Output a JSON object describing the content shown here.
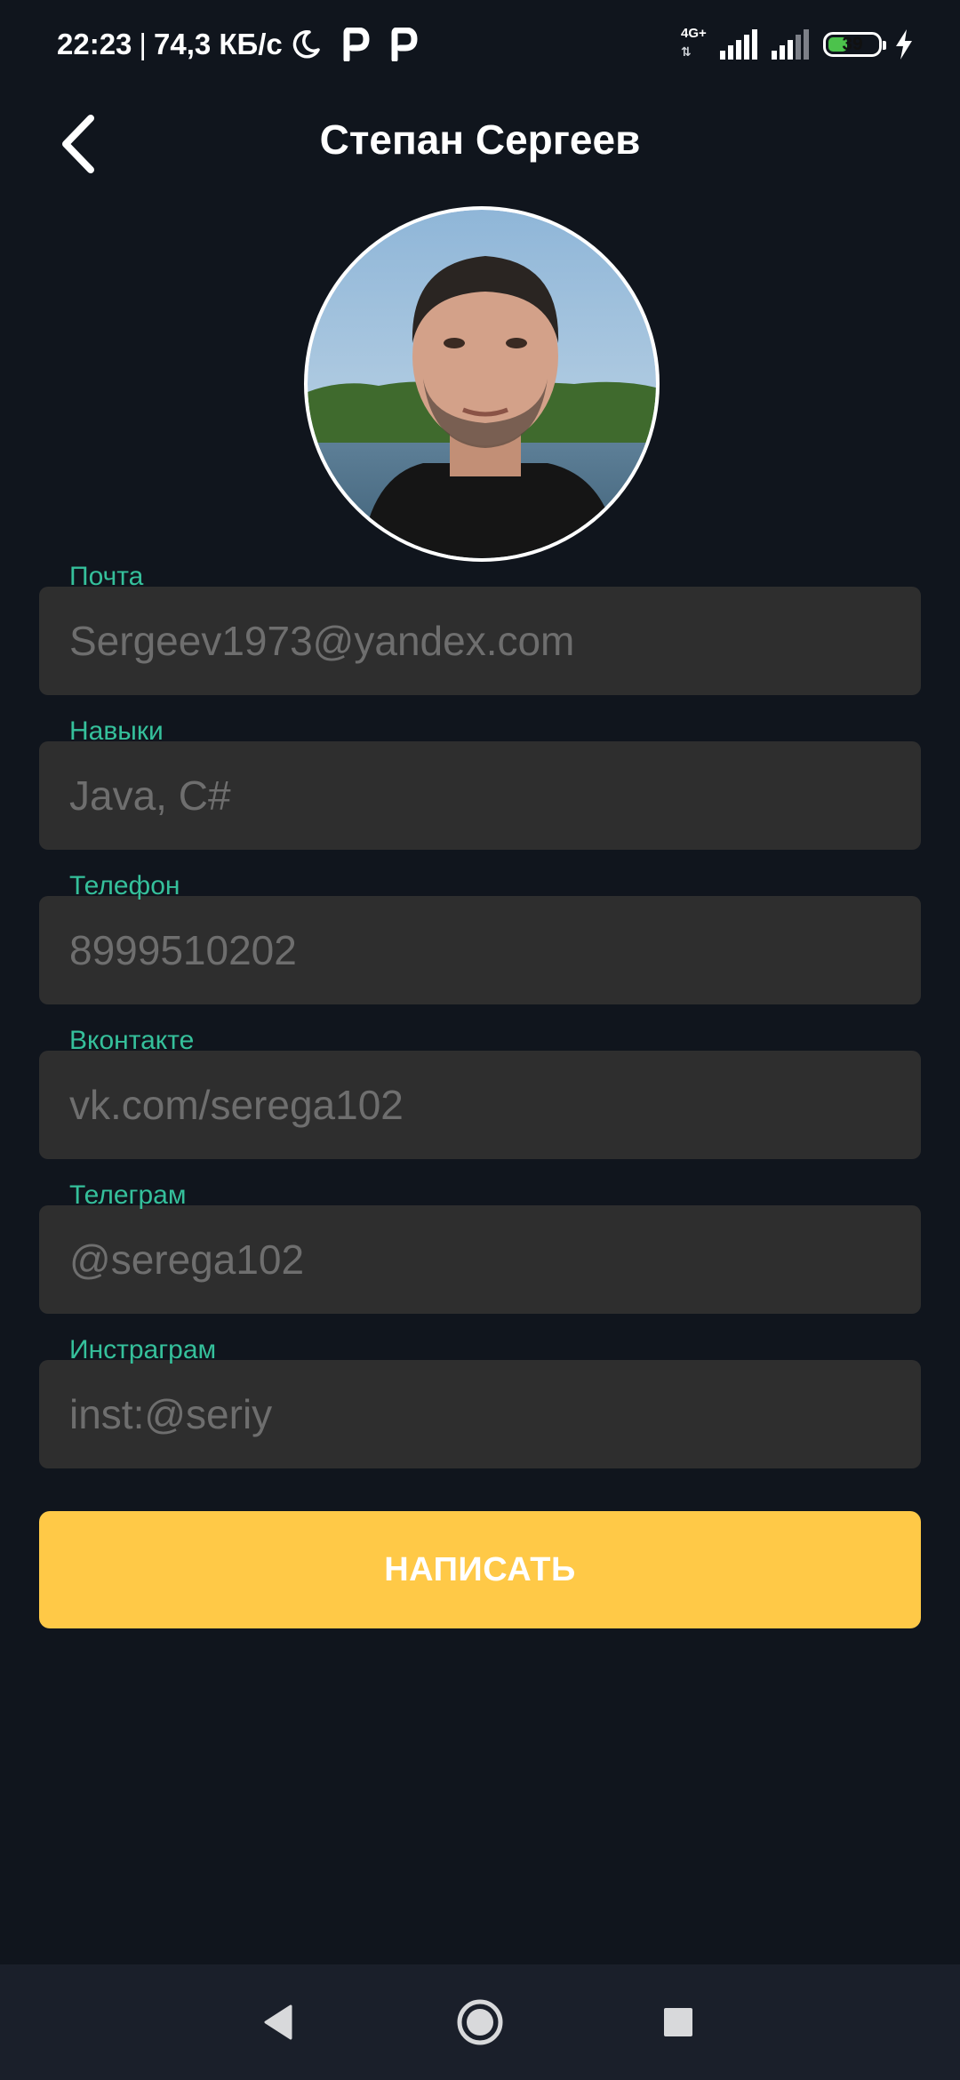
{
  "status_bar": {
    "time": "22:23",
    "separator": "|",
    "data_rate": "74,3 КБ/с",
    "network_type": "4G+",
    "battery_percent": "39",
    "battery_level": 0.39,
    "icons": [
      "moon-icon",
      "p-app-icon",
      "p-app-icon",
      "signal-icon",
      "signal-icon",
      "battery-icon",
      "charging-icon"
    ]
  },
  "header": {
    "title": "Степан Сергеев",
    "back_icon": "chevron-left-icon"
  },
  "profile": {
    "fields": [
      {
        "label": "Почта",
        "value": "Sergeev1973@yandex.com"
      },
      {
        "label": "Навыки",
        "value": "Java, C#"
      },
      {
        "label": "Телефон",
        "value": "8999510202"
      },
      {
        "label": "Вконтакте",
        "value": "vk.com/serega102"
      },
      {
        "label": "Телеграм",
        "value": "@serega102"
      },
      {
        "label": "Инстраграм",
        "value": "inst:@seriy"
      }
    ],
    "write_button": "НАПИСАТЬ"
  },
  "colors": {
    "background": "#10151d",
    "field_background": "#2e2e2e",
    "label_accent": "#35c09b",
    "button_accent": "#ffc947",
    "nav_bar": "#1a1f2a"
  },
  "nav_bar": {
    "icons": [
      "back-triangle-icon",
      "home-circle-icon",
      "recents-square-icon"
    ]
  }
}
